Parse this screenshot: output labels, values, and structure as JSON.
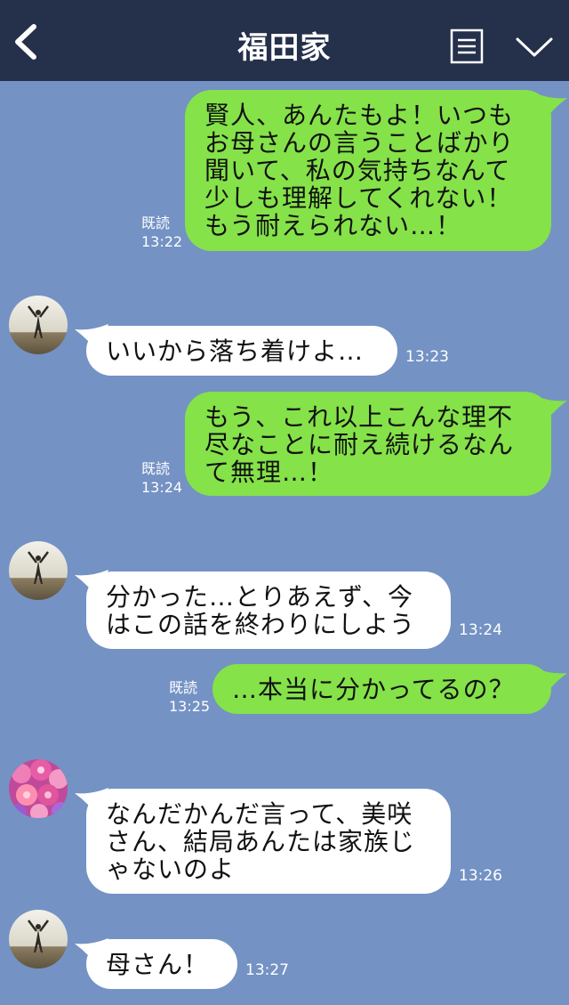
{
  "header": {
    "title": "福田家",
    "back_icon": "chevron-left-icon",
    "menu_icon": "menu-list-icon",
    "dropdown_icon": "chevron-down-icon"
  },
  "colors": {
    "background": "#7492c4",
    "header": "#25304b",
    "sent_bubble": "#85e249",
    "received_bubble": "#ffffff"
  },
  "messages": [
    {
      "side": "sent",
      "text": "賢人、あんたもよ！いつも\nお母さんの言うことばかり\n聞いて、私の気持ちなんて\n少しも理解してくれない！\nもう耐えられない…！",
      "read": "既読",
      "time": "13:22"
    },
    {
      "side": "received",
      "avatar": "person-silhouette-avatar",
      "text": "いいから落ち着けよ…",
      "time": "13:23"
    },
    {
      "side": "sent",
      "text": "もう、これ以上こんな理不\n尽なことに耐え続けるなん\nて無理…！",
      "read": "既読",
      "time": "13:24"
    },
    {
      "side": "received",
      "avatar": "person-silhouette-avatar",
      "text": "分かった…とりあえず、今\nはこの話を終わりにしよう",
      "time": "13:24"
    },
    {
      "side": "sent",
      "text": "…本当に分かってるの？",
      "read": "既読",
      "time": "13:25"
    },
    {
      "side": "received",
      "avatar": "pink-flowers-avatar",
      "text": "なんだかんだ言って、美咲\nさん、結局あんたは家族じ\nゃないのよ",
      "time": "13:26"
    },
    {
      "side": "received",
      "avatar": "person-silhouette-avatar",
      "text": "母さん！",
      "time": "13:27"
    }
  ]
}
